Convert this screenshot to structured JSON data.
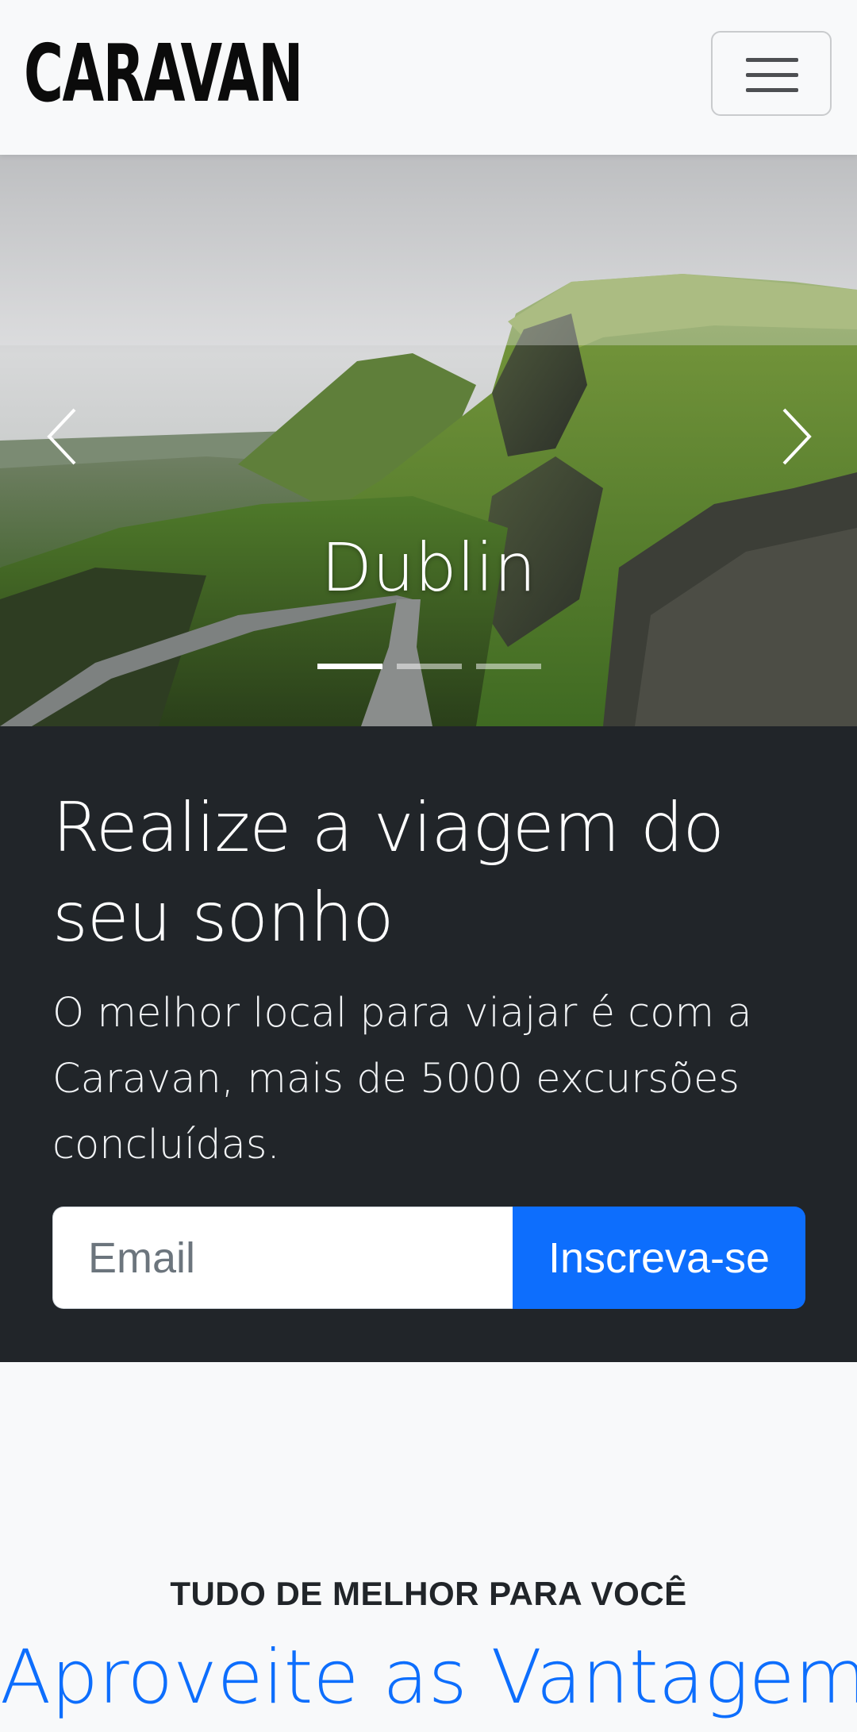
{
  "navbar": {
    "brand": "CARAVAN",
    "toggler_icon": "hamburger-menu-icon"
  },
  "carousel": {
    "caption": "Dublin",
    "prev_icon": "chevron-left-icon",
    "next_icon": "chevron-right-icon",
    "slide_count": 3,
    "active_slide": 1
  },
  "hero": {
    "title": "Realize a viagem do seu sonho",
    "lead": "O melhor local para viajar é com a Caravan, mais de 5000 excursões concluídas.",
    "email_placeholder": "Email",
    "subscribe_label": "Inscreva-se"
  },
  "features": {
    "eyebrow": "TUDO DE MELHOR PARA VOCÊ",
    "title": "Aproveite as Vantagem"
  },
  "colors": {
    "primary": "#0d6efd",
    "dark": "#212529",
    "light": "#f8f9fa"
  }
}
